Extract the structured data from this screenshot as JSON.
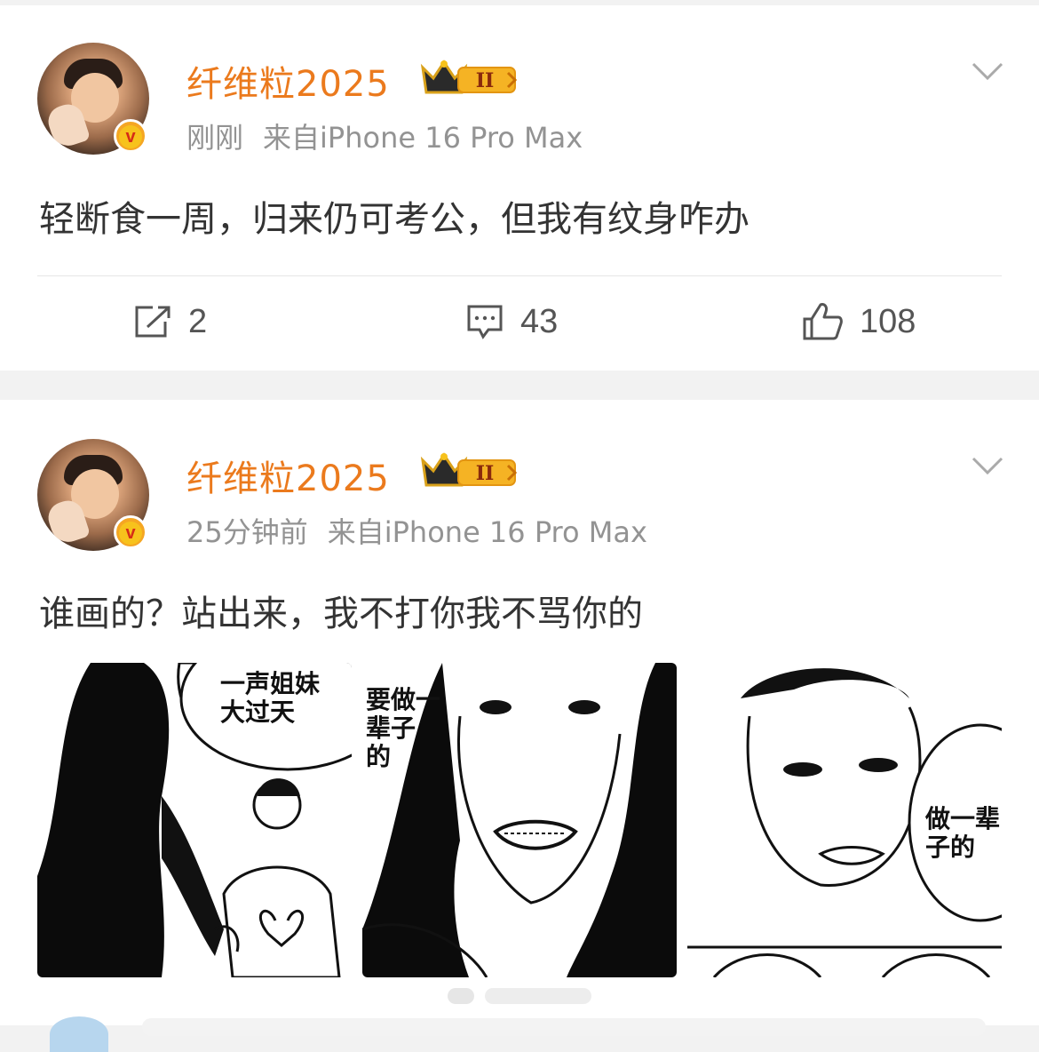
{
  "posts": [
    {
      "username": "纤维粒2025",
      "time": "刚刚",
      "source": "来自iPhone 16 Pro Max",
      "text": "轻断食一周，归来仍可考公，但我有纹身咋办",
      "actions": {
        "repost": "2",
        "comment": "43",
        "like": "108"
      },
      "badge_level": "II"
    },
    {
      "username": "纤维粒2025",
      "time": "25分钟前",
      "source": "来自iPhone 16 Pro Max",
      "text": "谁画的？站出来，我不打你我不骂你的",
      "badge_level": "II",
      "images": [
        {
          "caption": "一声姐妹\n大过天"
        },
        {
          "caption": "要做一\n辈子\n的"
        },
        {
          "caption": "做一辈\n子的"
        }
      ]
    }
  ],
  "icons": {
    "repost": "share-square-icon",
    "comment": "comment-icon",
    "like": "thumbs-up-icon",
    "menu": "chevron-down-icon",
    "verified": "verified-v-icon",
    "crown": "crown-badge-icon"
  },
  "colors": {
    "username": "#eb7a1d",
    "meta": "#939393",
    "text": "#333333",
    "badge_gold": "#f5a623"
  }
}
